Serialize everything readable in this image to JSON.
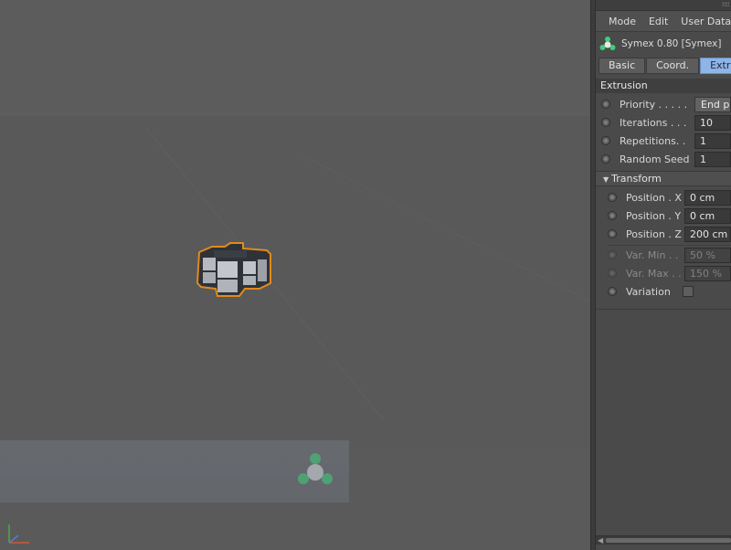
{
  "menubar": {
    "items": [
      "Mode",
      "Edit",
      "User Data"
    ]
  },
  "object": {
    "title": "Symex 0.80 [Symex]",
    "icon": "symex-object-icon"
  },
  "tabs": [
    {
      "label": "Basic",
      "active": false
    },
    {
      "label": "Coord.",
      "active": false
    },
    {
      "label": "Extrusion",
      "active": true
    }
  ],
  "extrusion": {
    "title": "Extrusion",
    "priority": {
      "label": "Priority . . . . .",
      "value": "End points"
    },
    "iterations": {
      "label": "Iterations . . .",
      "value": "10"
    },
    "repetitions": {
      "label": "Repetitions. .",
      "value": "1"
    },
    "random_seed": {
      "label": "Random Seed",
      "value": "1"
    }
  },
  "transform": {
    "title": "Transform",
    "position_x": {
      "label": "Position . X",
      "value": "0 cm"
    },
    "position_y": {
      "label": "Position . Y",
      "value": "0 cm"
    },
    "position_z": {
      "label": "Position . Z",
      "value": "200 cm"
    },
    "var_min": {
      "label": "Var. Min . .",
      "value": "50 %"
    },
    "var_max": {
      "label": "Var. Max . .",
      "value": "150 %"
    },
    "variation": {
      "label": "Variation",
      "checked": false
    }
  },
  "colors": {
    "active_tab": "#8fb4e6",
    "selection_outline": "#e08a1e",
    "viewport_bg": "#5a5a5a",
    "logo_green": "#3fcf7a"
  }
}
